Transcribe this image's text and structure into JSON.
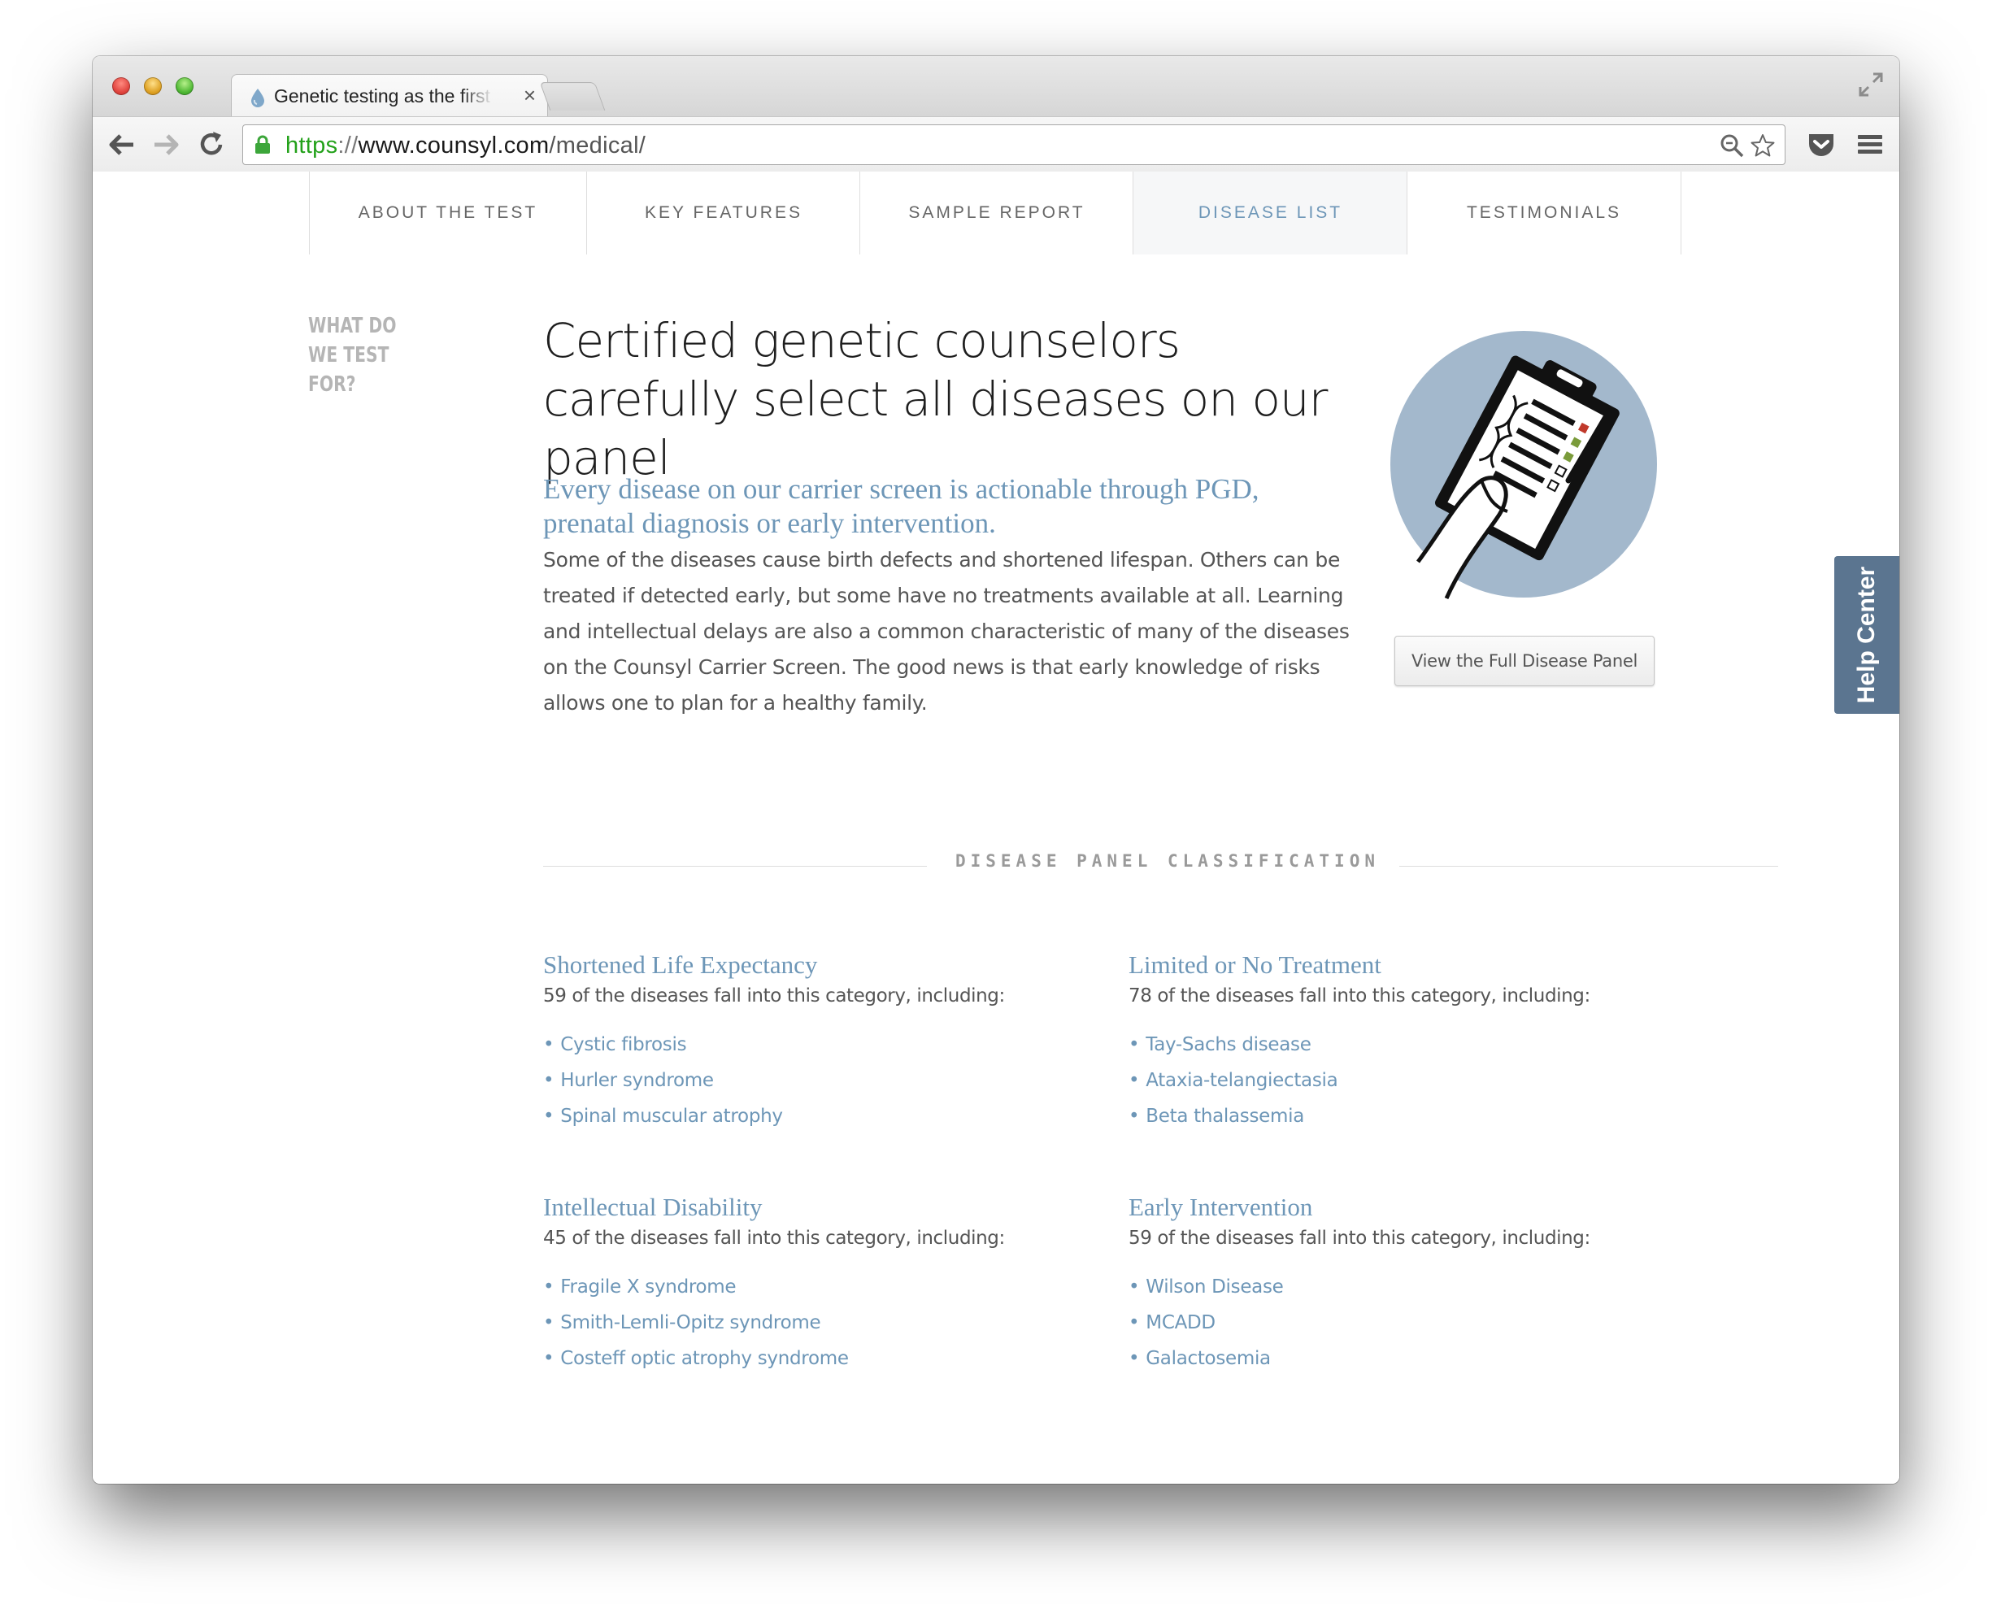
{
  "browser": {
    "tab_title": "Genetic testing as the first step",
    "tab_close_symbol": "×",
    "url": {
      "scheme": "https",
      "separator": "://",
      "host": "www.counsyl.com",
      "path": "/medical/"
    }
  },
  "site_nav": {
    "items": [
      {
        "label": "ABOUT THE TEST",
        "active": false
      },
      {
        "label": "KEY FEATURES",
        "active": false
      },
      {
        "label": "SAMPLE REPORT",
        "active": false
      },
      {
        "label": "DISEASE LIST",
        "active": true
      },
      {
        "label": "TESTIMONIALS",
        "active": false
      }
    ]
  },
  "section": {
    "label": "WHAT DO WE TEST FOR?",
    "headline": "Certified genetic counselors carefully select all diseases on our panel",
    "subhead": "Every disease on our carrier screen is actionable through PGD, prenatal diagnosis or early intervention.",
    "body": "Some of the diseases cause birth defects and shortened lifespan. Others can be treated if detected early, but some have no treatments available at all. Learning and intellectual delays are also a common characteristic of many of the diseases on the Counsyl Carrier Screen. The good news is that early knowledge of risks allows one to plan for a healthy family.",
    "button_label": "View the Full Disease Panel",
    "illustration_icon": "clipboard-dna-icon"
  },
  "classification": {
    "heading": "DISEASE PANEL CLASSIFICATION",
    "bullet": "•",
    "categories": [
      {
        "title": "Shortened Life Expectancy",
        "count": "59 of the diseases fall into this category, including:",
        "items": [
          "Cystic fibrosis",
          "Hurler syndrome",
          "Spinal muscular atrophy"
        ]
      },
      {
        "title": "Limited or No Treatment",
        "count": "78 of the diseases fall into this category, including:",
        "items": [
          "Tay-Sachs disease",
          "Ataxia-telangiectasia",
          "Beta thalassemia"
        ]
      },
      {
        "title": "Intellectual Disability",
        "count": "45 of the diseases fall into this category, including:",
        "items": [
          "Fragile X syndrome",
          "Smith-Lemli-Opitz syndrome",
          "Costeff optic atrophy syndrome"
        ]
      },
      {
        "title": "Early Intervention",
        "count": "59 of the diseases fall into this category, including:",
        "items": [
          "Wilson Disease",
          "MCADD",
          "Galactosemia"
        ]
      }
    ]
  },
  "help_center": {
    "label": "Help Center"
  },
  "colors": {
    "accent": "#6d96b7",
    "help_tab": "#5b7590",
    "url_scheme": "#23a11a",
    "illustration_circle": "#a3b8cc"
  }
}
